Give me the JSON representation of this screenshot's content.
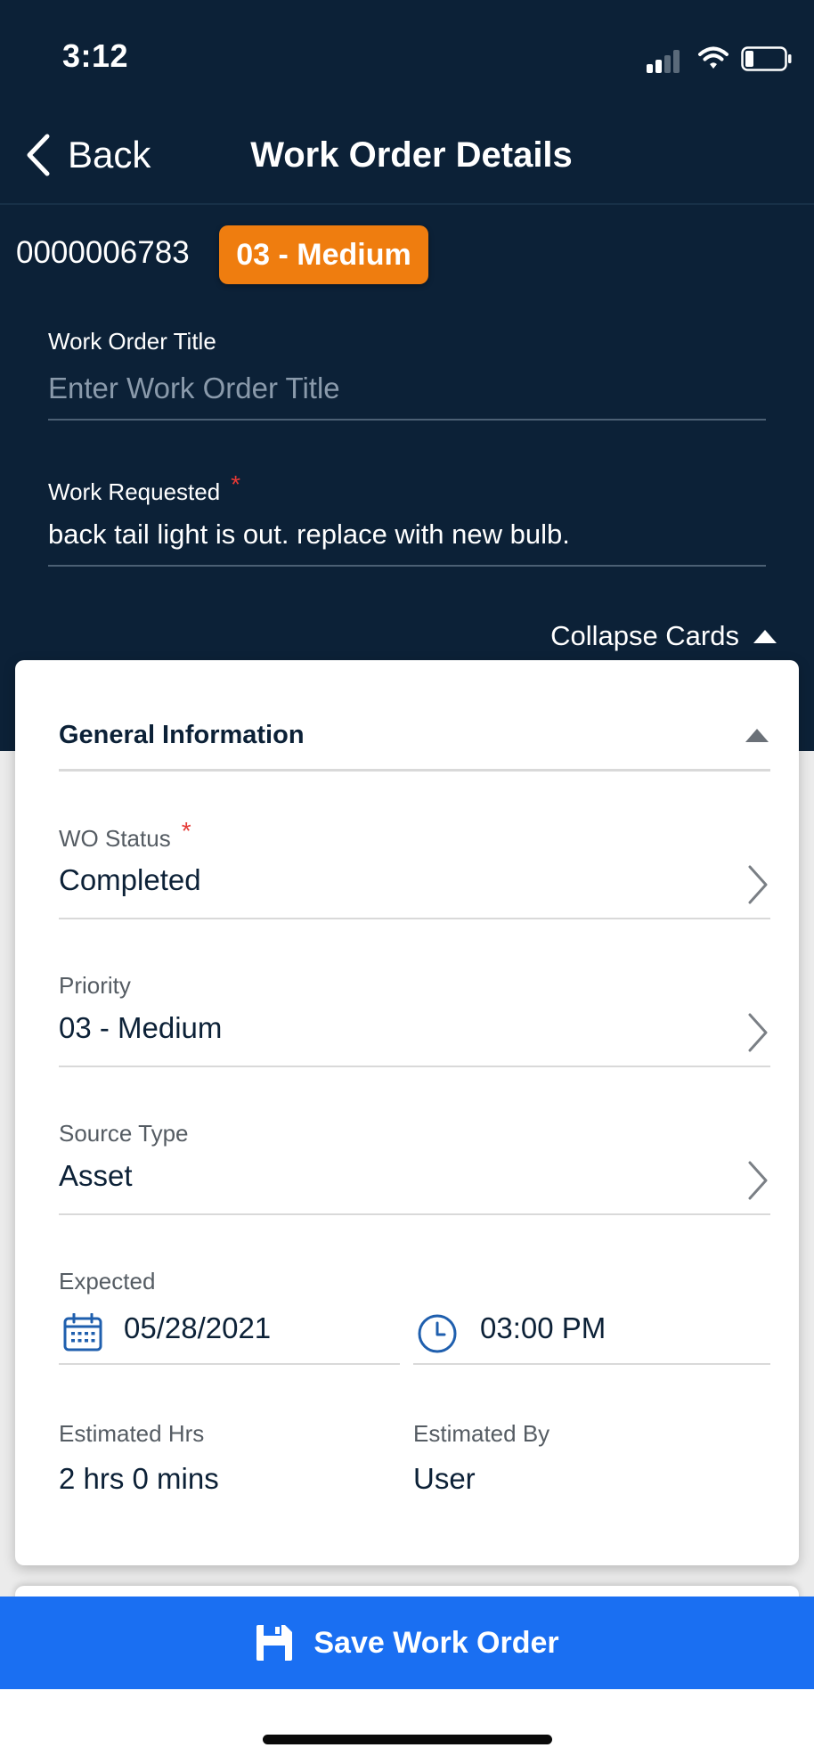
{
  "status_bar": {
    "time": "3:12",
    "icons": [
      "cellular-signal-icon",
      "wifi-icon",
      "battery-icon"
    ]
  },
  "nav": {
    "back_label": "Back",
    "title": "Work Order Details"
  },
  "work_order": {
    "number": "0000006783",
    "priority_badge": "03 - Medium",
    "title_label": "Work Order Title",
    "title_value": "",
    "title_placeholder": "Enter Work Order Title",
    "work_requested_label": "Work Requested",
    "work_requested_value": "back tail light is out.  replace with new bulb.",
    "required_mark": "*"
  },
  "collapse_cards_label": "Collapse Cards",
  "general_info": {
    "title": "General Information",
    "wo_status_label": "WO Status",
    "wo_status_value": "Completed",
    "priority_label": "Priority",
    "priority_value": "03 - Medium",
    "source_type_label": "Source Type",
    "source_type_value": "Asset",
    "expected_label": "Expected",
    "expected_date": "05/28/2021",
    "expected_time": "03:00 PM",
    "estimated_hrs_label": "Estimated Hrs",
    "estimated_hrs_value": "2 hrs 0 mins",
    "estimated_by_label": "Estimated By",
    "estimated_by_value": "User"
  },
  "save_button_label": "Save Work Order",
  "colors": {
    "header_bg": "#0c2137",
    "badge_orange": "#ef7d0f",
    "save_blue": "#1a6ff2",
    "required_red": "#e53935",
    "calendar_blue": "#1f5fae"
  }
}
